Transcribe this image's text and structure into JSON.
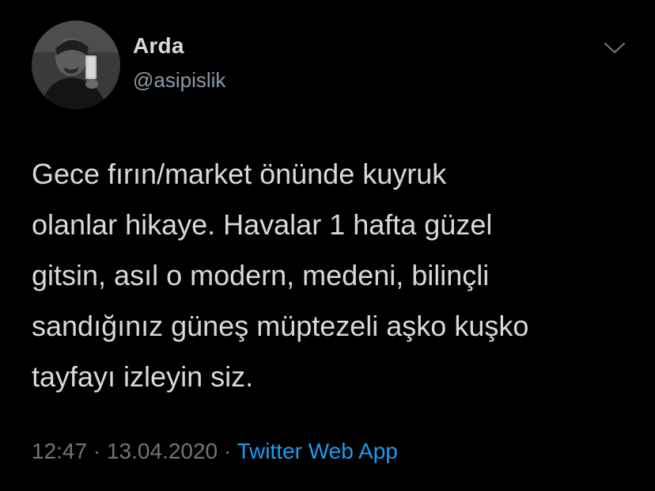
{
  "tweet": {
    "author": {
      "display_name": "Arda",
      "handle": "@asipislik",
      "avatar_icon": "user-avatar-photo"
    },
    "menu_icon": "chevron-down-icon",
    "text": "Gece fırın/market önünde kuyruk\nolanlar hikaye. Havalar 1 hafta güzel\ngitsin, asıl o modern, medeni, bilinçli\nsandığınız güneş müptezeli aşko kuşko\ntayfayı izleyin siz.",
    "time": "12:47",
    "separator": " · ",
    "date": "13.04.2020",
    "source": "Twitter Web App"
  },
  "colors": {
    "background": "#000000",
    "primary_text": "#d9d9d9",
    "secondary_text": "#8b98a5",
    "meta_text": "#6e767d",
    "link": "#1d9bf0"
  }
}
